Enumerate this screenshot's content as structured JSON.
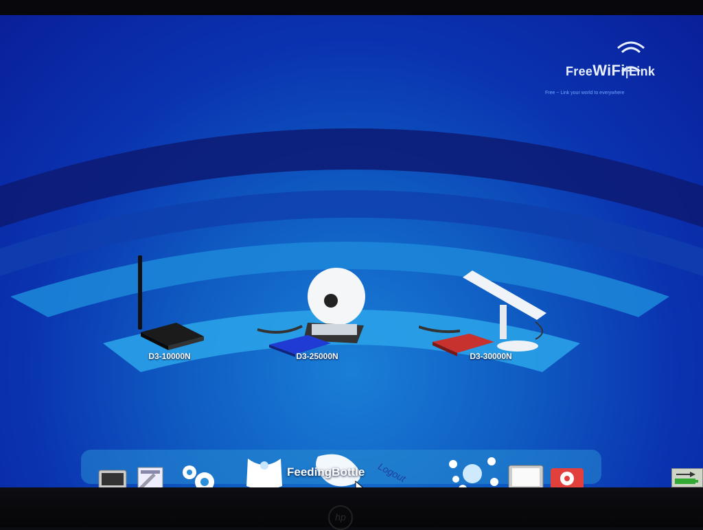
{
  "brand": {
    "name_free": "Free",
    "name_wifi": "WiFi",
    "name_link": "Link",
    "tagline": "Free ~ Link your world to everywhere"
  },
  "devices": [
    {
      "label": "D3-10000N",
      "icon": "router-antenna-icon",
      "color": "#1a1a1a"
    },
    {
      "label": "D3-25000N",
      "icon": "dish-antenna-icon",
      "color": "#1f3bd4"
    },
    {
      "label": "D3-30000N",
      "icon": "panel-antenna-icon",
      "color": "#c8322e"
    }
  ],
  "dock": {
    "active_item_label": "FeedingBottle",
    "logout_label": "Logout",
    "items": [
      "terminal-icon",
      "system-tools-icon",
      "gears-icon",
      "bib-icon",
      "feeding-bottle-icon",
      "logout-icon",
      "network-icon",
      "display-icon",
      "settings-icon"
    ]
  },
  "colors": {
    "accent": "#1a7fd6",
    "background_dark": "#0a1f9a"
  }
}
